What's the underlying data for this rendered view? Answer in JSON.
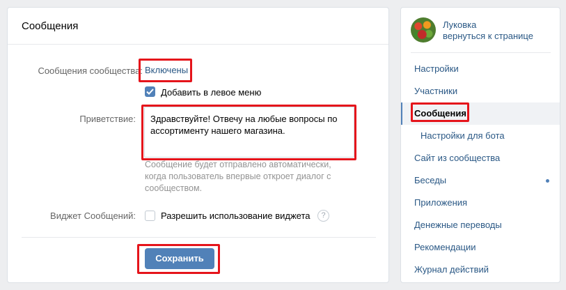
{
  "main": {
    "title": "Сообщения",
    "community_messages_label": "Сообщения сообщества:",
    "community_messages_value": "Включены",
    "add_to_menu_label": "Добавить в левое меню",
    "add_to_menu_checked": true,
    "greeting_label": "Приветствие:",
    "greeting_value": "Здравствуйте! Отвечу на любые вопросы по ассортименту нашего магазина.",
    "greeting_hint": "Сообщение будет отправлено автоматически, когда пользователь впервые откроет диалог с сообществом.",
    "widget_label": "Виджет Сообщений:",
    "widget_checkbox_label": "Разрешить использование виджета",
    "widget_checked": false,
    "help_glyph": "?",
    "save_label": "Сохранить"
  },
  "sidebar": {
    "group_name": "Луковка",
    "back_link": "вернуться к странице",
    "items": [
      {
        "label": "Настройки"
      },
      {
        "label": "Участники"
      },
      {
        "label": "Сообщения"
      },
      {
        "label": "Настройки для бота"
      },
      {
        "label": "Сайт из сообщества"
      },
      {
        "label": "Беседы"
      },
      {
        "label": "Приложения"
      },
      {
        "label": "Денежные переводы"
      },
      {
        "label": "Рекомендации"
      },
      {
        "label": "Журнал действий"
      }
    ]
  },
  "colors": {
    "accent": "#5181b8",
    "link": "#2a5885",
    "highlight_frame": "#e5141b"
  },
  "icons": {
    "checkbox": "check-icon",
    "help": "question-circle-icon",
    "unread": "dot-indicator"
  }
}
